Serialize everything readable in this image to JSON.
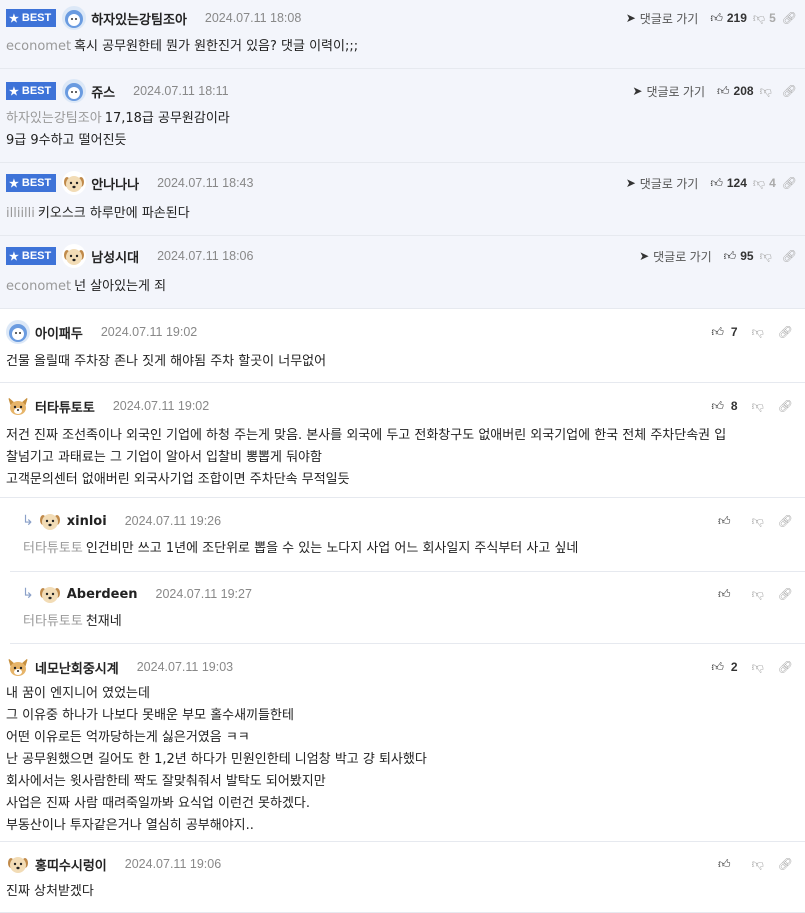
{
  "comments": [
    {
      "best": true,
      "badge": "BEST",
      "nick": "하자있는강팀조아",
      "date": "2024.07.11 18:08",
      "goto": "댓글로 가기",
      "up": "219",
      "down": "5",
      "mention": "economet",
      "lines": [
        "혹시 공무원한테 뭔가 원한진거 있음? 댓글 이력이;;;"
      ],
      "avatar": "blue"
    },
    {
      "best": true,
      "badge": "BEST",
      "nick": "쥬스",
      "date": "2024.07.11 18:11",
      "goto": "댓글로 가기",
      "up": "208",
      "down": "",
      "mention": "하자있는강팀조아",
      "lines": [
        "17,18급 공무원감이라",
        "9급 9수하고 떨어진듯"
      ],
      "avatar": "blue"
    },
    {
      "best": true,
      "badge": "BEST",
      "nick": "안나나나",
      "date": "2024.07.11 18:43",
      "goto": "댓글로 가기",
      "up": "124",
      "down": "4",
      "mention": "illiilli",
      "lines": [
        "키오스크 하루만에 파손된다"
      ],
      "avatar": "dog"
    },
    {
      "best": true,
      "badge": "BEST",
      "nick": "남성시대",
      "date": "2024.07.11 18:06",
      "goto": "댓글로 가기",
      "up": "95",
      "down": "",
      "mention": "economet",
      "lines": [
        "넌 살아있는게 죄"
      ],
      "avatar": "dog"
    },
    {
      "best": false,
      "nick": "아이패두",
      "date": "2024.07.11 19:02",
      "up": "7",
      "lines": [
        "건물 올릴때 주차장 존나 짓게 해야됨 주차 할곳이 너무없어"
      ],
      "avatar": "blue"
    },
    {
      "best": false,
      "nick": "터타튜토토",
      "date": "2024.07.11 19:02",
      "up": "8",
      "lines": [
        "저건 진짜 조선족이나 외국인 기업에 하청 주는게 맞음. 본사를 외국에 두고 전화창구도 없애버린 외국기업에 한국 전체 주차단속권 입",
        "찰넘기고 과태료는 그 기업이 알아서 입찰비 뽕뽑게 둬야함",
        "고객문의센터 없애버린 외국사기업 조합이면 주차단속 무적일듯"
      ],
      "avatar": "fox"
    },
    {
      "best": false,
      "reply": true,
      "nick": "xinloi",
      "date": "2024.07.11 19:26",
      "up": "",
      "mention": "터타튜토토",
      "lines": [
        "인건비만 쓰고 1년에 조단위로 뽑을 수 있는 노다지 사업 어느 회사일지 주식부터 사고 싶네"
      ],
      "avatar": "dog"
    },
    {
      "best": false,
      "reply": true,
      "nick": "Aberdeen",
      "date": "2024.07.11 19:27",
      "up": "",
      "mention": "터타튜토토",
      "lines": [
        "천재네"
      ],
      "avatar": "dog"
    },
    {
      "best": false,
      "nick": "네모난회중시계",
      "date": "2024.07.11 19:03",
      "up": "2",
      "lines": [
        "내 꿈이 엔지니어 였었는데",
        "그 이유중 하나가 나보다 못배운 부모 홀수새끼들한테",
        "어떤 이유로든 억까당하는게 싫은거였음 ㅋㅋ",
        "난 공무원했으면 길어도 한 1,2년 하다가 민원인한테 니엄창 박고 걍 퇴사했다",
        "회사에서는 윗사람한테 짝도 잘맞춰줘서 발탁도 되어봤지만",
        "사업은 진짜 사람 때려죽일까봐 요식업 이런건 못하겠다.",
        "부동산이나 투자같은거나 열심히 공부해야지.."
      ],
      "avatar": "fox"
    },
    {
      "best": false,
      "nick": "홍띠수시렁이",
      "date": "2024.07.11 19:06",
      "up": "",
      "lines": [
        "진짜 상처받겠다"
      ],
      "avatar": "dog"
    }
  ],
  "icons": {
    "thumbs_up": "thumbs-up-icon",
    "thumbs_down": "thumbs-down-icon",
    "link": "link-icon",
    "goto": "arrow-icon",
    "star": "star-icon"
  },
  "colors": {
    "best_bg": "#f3f5fb",
    "badge": "#3e73d8",
    "border": "#e6e9ef"
  }
}
